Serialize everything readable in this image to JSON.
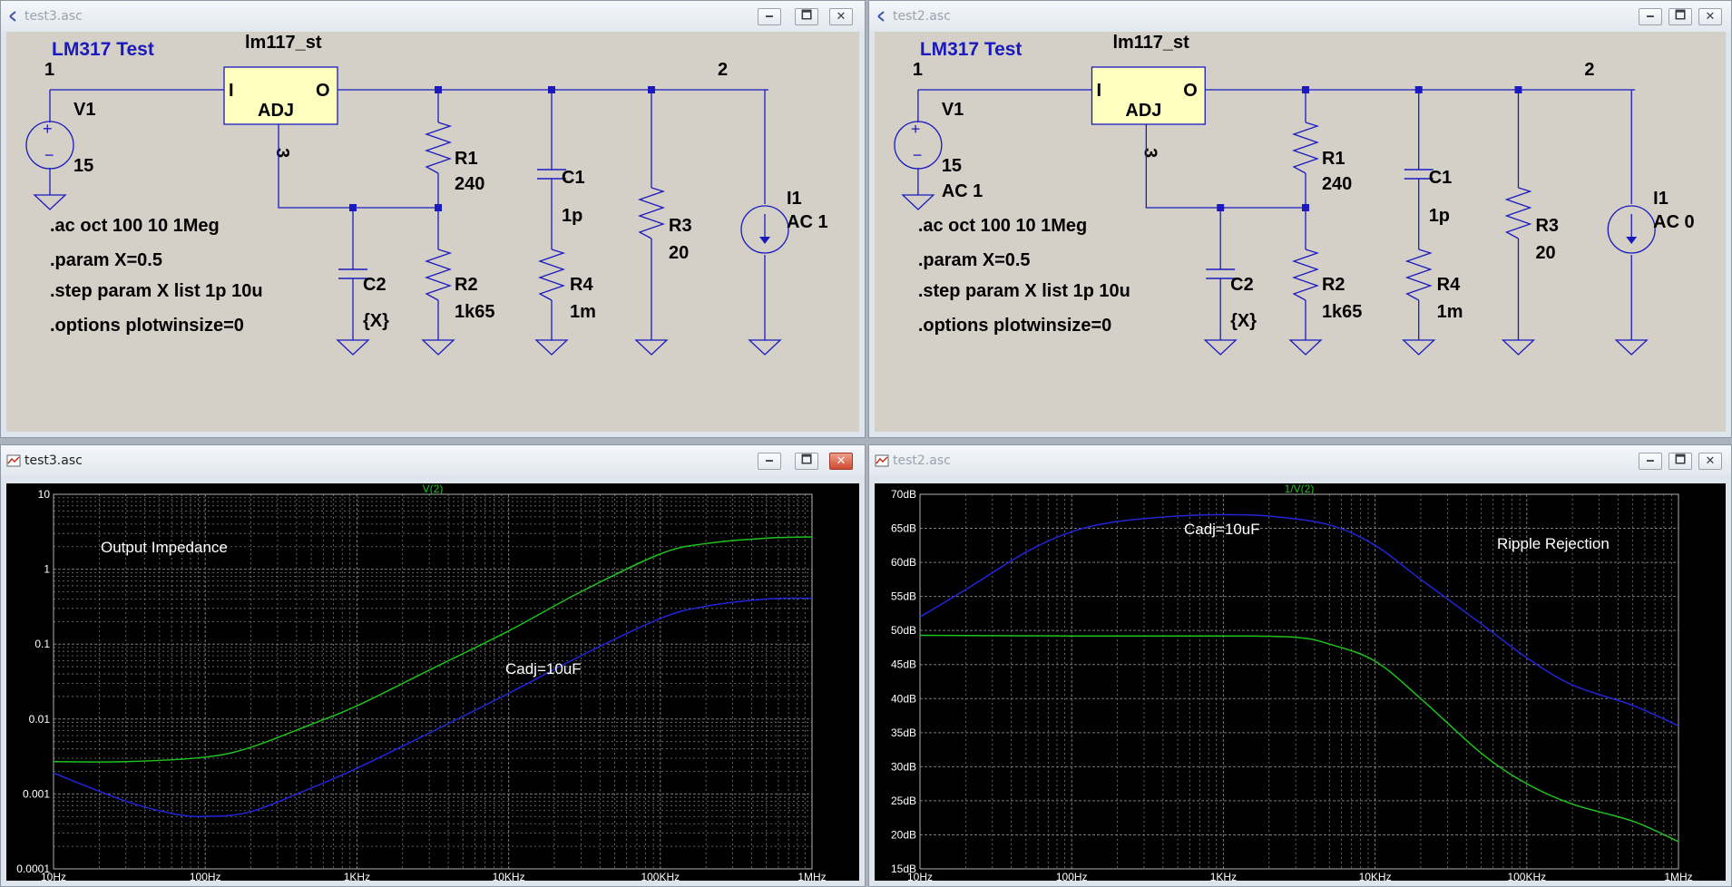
{
  "windows": [
    {
      "title": "test3.asc"
    },
    {
      "title": "test2.asc"
    },
    {
      "title": "test3.asc"
    },
    {
      "title": "test2.asc"
    }
  ],
  "window_buttons": {
    "minimize": "🗕",
    "maximize": "🗖",
    "close": "✕"
  },
  "schematics": [
    {
      "title": "LM317 Test",
      "regulator": {
        "name": "lm117_st",
        "in": "I",
        "out": "O",
        "adj": "ADJ"
      },
      "nodes": {
        "n1": "1",
        "n2": "2",
        "n3": "3"
      },
      "v1": {
        "name": "V1",
        "value": "15",
        "ac": ""
      },
      "r1": {
        "name": "R1",
        "value": "240"
      },
      "r2": {
        "name": "R2",
        "value": "1k65"
      },
      "r3": {
        "name": "R3",
        "value": "20"
      },
      "r4": {
        "name": "R4",
        "value": "1m"
      },
      "c1": {
        "name": "C1",
        "value": "1p"
      },
      "c2": {
        "name": "C2",
        "value": "{X}"
      },
      "i1": {
        "name": "I1",
        "value": "AC 1"
      },
      "directives": [
        ".ac oct 100 10 1Meg",
        ".param X=0.5",
        ".step param X list 1p 10u",
        ".options plotwinsize=0"
      ]
    },
    {
      "title": "LM317 Test",
      "regulator": {
        "name": "lm117_st",
        "in": "I",
        "out": "O",
        "adj": "ADJ"
      },
      "nodes": {
        "n1": "1",
        "n2": "2",
        "n3": "3"
      },
      "v1": {
        "name": "V1",
        "value": "15",
        "ac": "AC 1"
      },
      "r1": {
        "name": "R1",
        "value": "240"
      },
      "r2": {
        "name": "R2",
        "value": "1k65"
      },
      "r3": {
        "name": "R3",
        "value": "20"
      },
      "r4": {
        "name": "R4",
        "value": "1m"
      },
      "c1": {
        "name": "C1",
        "value": "1p"
      },
      "c2": {
        "name": "C2",
        "value": "{X}"
      },
      "i1": {
        "name": "I1",
        "value": "AC 0"
      },
      "directives": [
        ".ac oct 100 10 1Meg",
        ".param X=0.5",
        ".step param X list 1p 10u",
        ".options plotwinsize=0"
      ]
    }
  ],
  "colors": {
    "schematic_bg": "#d4d0c8",
    "wire": "#1a1abf",
    "text": "#000000",
    "title": "#1a1abf",
    "symbol_fill": "#ffffc0",
    "grid": "#7a7a7a",
    "trace_green": "#1ec21e",
    "trace_blue": "#2424d8",
    "plot_bg": "#000000",
    "plot_text": "#ffffff"
  },
  "chart_data": [
    {
      "type": "line",
      "title": "V(2)",
      "xscale": "log",
      "yscale": "log",
      "xlim": [
        10,
        1000000
      ],
      "ylim": [
        0.0001,
        10
      ],
      "xticks": [
        "10Hz",
        "100Hz",
        "1KHz",
        "10KHz",
        "100KHz",
        "1MHz"
      ],
      "yticks": [
        "10",
        "1",
        "0.1",
        "0.01",
        "0.001",
        "0.0001"
      ],
      "annotations": [
        "Output Impedance",
        "Cadj=10uF"
      ],
      "series": [
        {
          "color": "#1ec21e",
          "x": [
            10,
            30,
            100,
            200,
            500,
            1000,
            3000,
            10000,
            30000,
            100000,
            200000,
            500000,
            1000000
          ],
          "y": [
            0.0027,
            0.0027,
            0.0031,
            0.0042,
            0.0085,
            0.015,
            0.045,
            0.15,
            0.5,
            1.6,
            2.2,
            2.6,
            2.7
          ]
        },
        {
          "color": "#2424d8",
          "x": [
            10,
            30,
            60,
            100,
            200,
            500,
            1000,
            3000,
            10000,
            30000,
            100000,
            200000,
            500000,
            1000000
          ],
          "y": [
            0.0019,
            0.0008,
            0.00055,
            0.0005,
            0.00058,
            0.0012,
            0.0022,
            0.0065,
            0.022,
            0.07,
            0.22,
            0.32,
            0.4,
            0.41
          ]
        }
      ]
    },
    {
      "type": "line",
      "title": "1/V(2)",
      "xscale": "log",
      "xlim": [
        10,
        1000000
      ],
      "ylim": [
        15,
        70
      ],
      "xticks": [
        "10Hz",
        "100Hz",
        "1KHz",
        "10KHz",
        "100KHz",
        "1MHz"
      ],
      "yticks": [
        "70dB",
        "65dB",
        "60dB",
        "55dB",
        "50dB",
        "45dB",
        "40dB",
        "35dB",
        "30dB",
        "25dB",
        "20dB",
        "15dB"
      ],
      "annotations": [
        "Cadj=10uF",
        "Ripple Rejection"
      ],
      "series": [
        {
          "color": "#2424d8",
          "x": [
            10,
            20,
            50,
            100,
            200,
            500,
            1000,
            2000,
            5000,
            10000,
            20000,
            50000,
            100000,
            200000,
            500000,
            1000000
          ],
          "y": [
            52,
            56,
            61.5,
            64.5,
            66,
            66.8,
            67,
            66.8,
            65.5,
            62.5,
            57.5,
            51,
            46,
            42,
            39,
            36
          ]
        },
        {
          "color": "#1ec21e",
          "x": [
            10,
            100,
            1000,
            3000,
            5000,
            10000,
            20000,
            50000,
            100000,
            200000,
            500000,
            1000000
          ],
          "y": [
            49.3,
            49.2,
            49.2,
            49,
            48,
            45.5,
            40,
            32,
            27.5,
            24.5,
            22,
            19
          ]
        }
      ]
    }
  ]
}
